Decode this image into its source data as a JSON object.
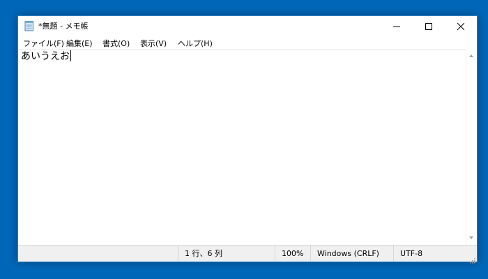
{
  "window": {
    "title": "*無題 - メモ帳",
    "icon": "notepad-icon",
    "controls": {
      "minimize_icon": "minimize-icon",
      "maximize_icon": "maximize-icon",
      "close_icon": "close-icon"
    }
  },
  "menu": {
    "items": [
      {
        "label": "ファイル(F)"
      },
      {
        "label": "編集(E)"
      },
      {
        "label": "書式(O)"
      },
      {
        "label": "表示(V)"
      },
      {
        "label": "ヘルプ(H)"
      }
    ]
  },
  "editor": {
    "content": "あいうえお"
  },
  "status": {
    "position": "1 行、6 列",
    "zoom": "100%",
    "line_ending": "Windows (CRLF)",
    "encoding": "UTF-8"
  },
  "colors": {
    "desktop": "#0067b8",
    "window_border": "#2d7fc8",
    "statusbar": "#f0f0f0"
  }
}
